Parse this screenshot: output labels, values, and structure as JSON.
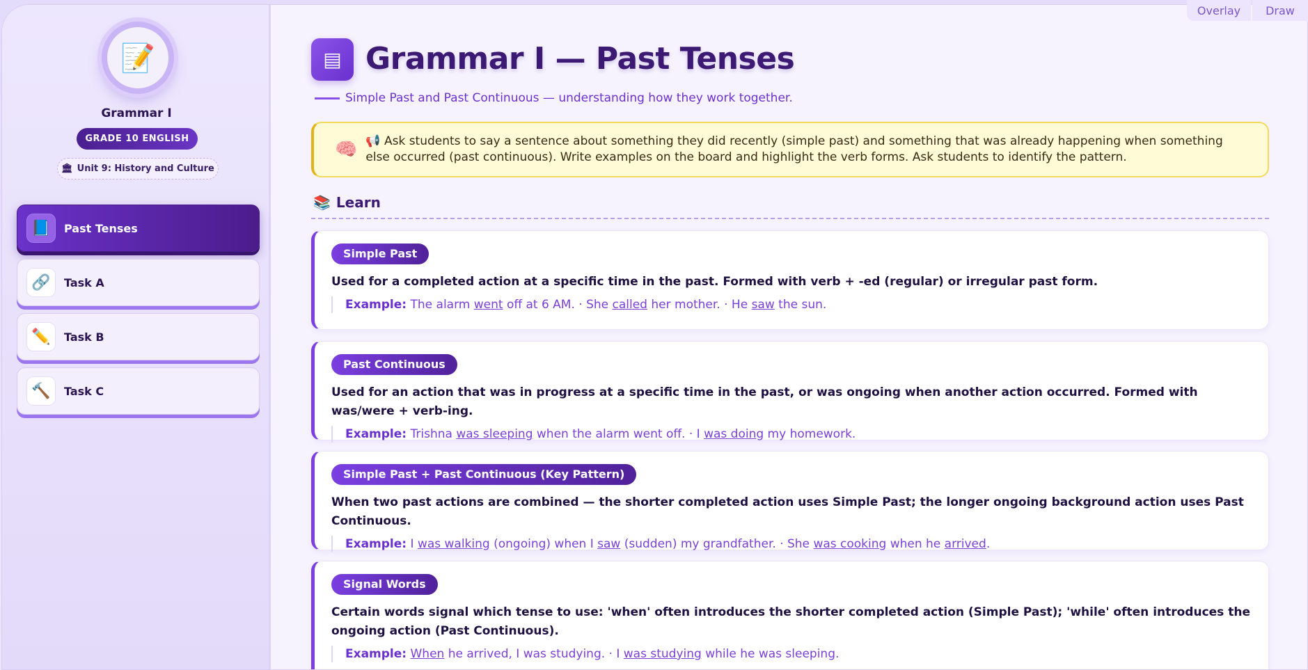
{
  "top_buttons": {
    "overlay": "Overlay",
    "draw": "Draw"
  },
  "sidebar": {
    "avatar_icon": "memo-pencil-icon",
    "title": "Grammar I",
    "grade": "GRADE 10 ENGLISH",
    "unit_icon": "🏛",
    "unit": "Unit 9: History and Culture",
    "items": [
      {
        "label": "Past Tenses",
        "icon": "📘",
        "active": true
      },
      {
        "label": "Task A",
        "icon": "🔗",
        "active": false
      },
      {
        "label": "Task B",
        "icon": "✏️",
        "active": false
      },
      {
        "label": "Task C",
        "icon": "🔨",
        "active": false
      }
    ]
  },
  "header": {
    "title": "Grammar I — Past Tenses",
    "subtitle": "Simple Past and Past Continuous — understanding how they work together."
  },
  "note": {
    "icon": "🧠",
    "megaphone": "📢",
    "text": "Ask students to say a sentence about something they did recently (simple past) and something that was already happening when something else occurred (past continuous). Write examples on the board and highlight the verb forms. Ask students to identify the pattern."
  },
  "learn": {
    "icon": "📚",
    "label": "Learn"
  },
  "example_label": "Example:",
  "cards": [
    {
      "tag": "Simple Past",
      "desc": "Used for a completed action at a specific time in the past. Formed with verb + -ed (regular) or irregular past form.",
      "example": [
        {
          "t": "The alarm "
        },
        {
          "t": "went",
          "u": true
        },
        {
          "t": " off at 6 AM. · She "
        },
        {
          "t": "called",
          "u": true
        },
        {
          "t": " her mother. · He "
        },
        {
          "t": "saw",
          "u": true
        },
        {
          "t": " the sun."
        }
      ]
    },
    {
      "tag": "Past Continuous",
      "desc": "Used for an action that was in progress at a specific time in the past, or was ongoing when another action occurred. Formed with was/were + verb-ing.",
      "example": [
        {
          "t": "Trishna "
        },
        {
          "t": "was sleeping",
          "u": true
        },
        {
          "t": " when the alarm went off. · I "
        },
        {
          "t": "was doing",
          "u": true
        },
        {
          "t": " my homework."
        }
      ]
    },
    {
      "tag": "Simple Past + Past Continuous (Key Pattern)",
      "desc": "When two past actions are combined — the shorter completed action uses Simple Past; the longer ongoing background action uses Past Continuous.",
      "example": [
        {
          "t": "I "
        },
        {
          "t": "was walking",
          "u": true
        },
        {
          "t": " (ongoing) when I "
        },
        {
          "t": "saw",
          "u": true
        },
        {
          "t": " (sudden) my grandfather. · She "
        },
        {
          "t": "was cooking",
          "u": true
        },
        {
          "t": " when he "
        },
        {
          "t": "arrived",
          "u": true
        },
        {
          "t": "."
        }
      ]
    },
    {
      "tag": "Signal Words",
      "desc": "Certain words signal which tense to use: 'when' often introduces the shorter completed action (Simple Past); 'while' often introduces the ongoing action (Past Continuous).",
      "example": [
        {
          "t": "When",
          "u": true
        },
        {
          "t": " he arrived, I was studying. · I "
        },
        {
          "t": "was studying",
          "u": true
        },
        {
          "t": " while he was sleeping."
        }
      ]
    }
  ]
}
